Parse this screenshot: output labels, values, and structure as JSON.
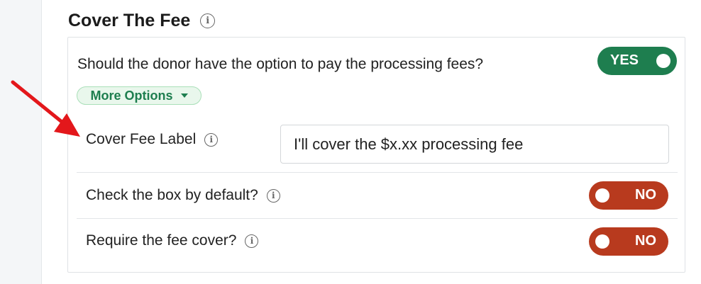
{
  "section": {
    "title": "Cover The Fee",
    "info_icon": "info-icon"
  },
  "main_option": {
    "question": "Should the donor have the option to pay the processing fees?",
    "toggle_label": "YES",
    "toggle_color": "#1e7e4f"
  },
  "more_options": {
    "label": "More Options",
    "icon": "caret-down-icon"
  },
  "cover_fee_label": {
    "label": "Cover Fee Label",
    "value": "I'll cover the $x.xx processing fee"
  },
  "check_default": {
    "label": "Check the box by default?",
    "toggle_label": "NO",
    "toggle_color": "#b83a1e"
  },
  "require_fee": {
    "label": "Require the fee cover?",
    "toggle_label": "NO",
    "toggle_color": "#b83a1e"
  },
  "annotation": {
    "arrow_icon": "red-arrow-icon",
    "arrow_color": "#e3171b"
  }
}
